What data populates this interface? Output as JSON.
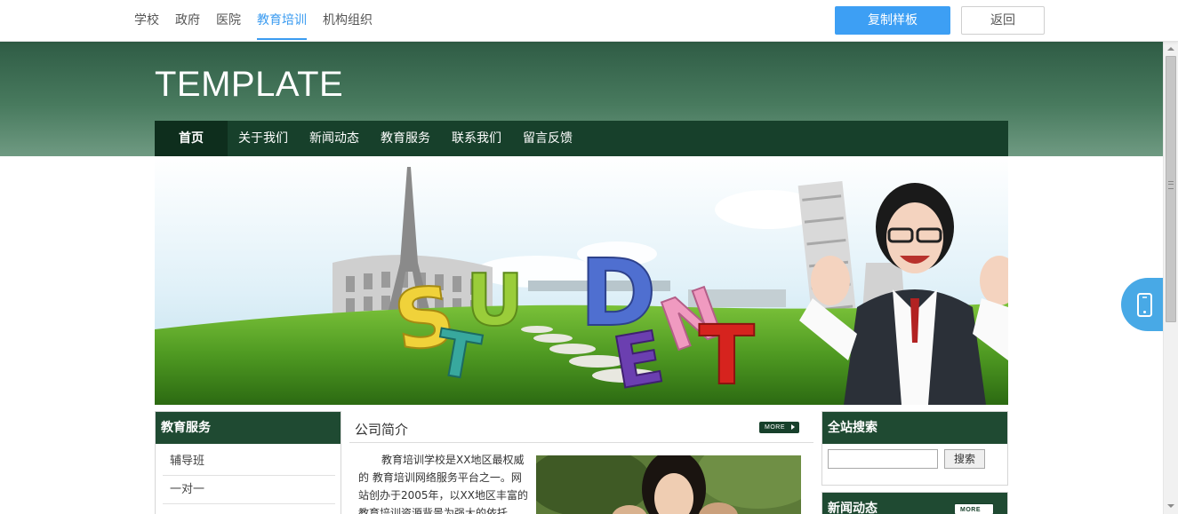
{
  "topbar": {
    "categories": [
      {
        "label": "学校"
      },
      {
        "label": "政府"
      },
      {
        "label": "医院"
      },
      {
        "label": "教育培训",
        "active": true
      },
      {
        "label": "机构组织"
      }
    ],
    "copy_button": "复制样板",
    "back_button": "返回"
  },
  "header": {
    "title": "TEMPLATE",
    "nav": [
      {
        "label": "首页",
        "active": true
      },
      {
        "label": "关于我们"
      },
      {
        "label": "新闻动态"
      },
      {
        "label": "教育服务"
      },
      {
        "label": "联系我们"
      },
      {
        "label": "留言反馈"
      }
    ]
  },
  "banner": {
    "text": "STUDENT"
  },
  "left": {
    "title": "教育服务",
    "items": [
      "辅导班",
      "一对一"
    ]
  },
  "middle": {
    "title": "公司简介",
    "more": "MORE",
    "intro": "教育培训学校是XX地区最权威的 教育培训网络服务平台之一。网站创办于2005年，以XX地区丰富的教育培训资源背景为强大的依托"
  },
  "right": {
    "search_title": "全站搜索",
    "search_button": "搜索",
    "search_value": "",
    "news_title": "新闻动态",
    "more": "MORE"
  },
  "colors": {
    "accent": "#3d9ff4",
    "header_green": "#17402b",
    "nav_active": "#0e2e1d"
  },
  "icons": {
    "phone": "mobile-phone-icon"
  }
}
